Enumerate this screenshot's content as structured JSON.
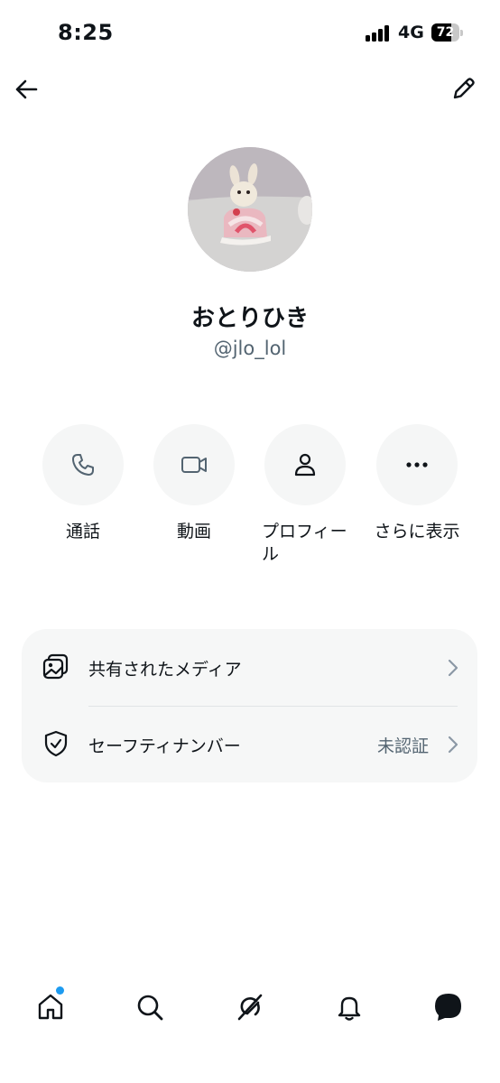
{
  "status_bar": {
    "time": "8:25",
    "network": "4G",
    "battery": "72",
    "battery_level": 0.72
  },
  "header": {
    "back_icon": "arrow-left-icon",
    "edit_icon": "pencil-icon"
  },
  "profile": {
    "display_name": "おとりひき",
    "handle": "@jlo_lol"
  },
  "actions": [
    {
      "label": "通話",
      "icon": "phone-icon"
    },
    {
      "label": "動画",
      "icon": "video-camera-icon"
    },
    {
      "label": "プロフィール",
      "icon": "person-icon"
    },
    {
      "label": "さらに表示",
      "icon": "more-dots-icon"
    }
  ],
  "settings": {
    "shared_media": {
      "label": "共有されたメディア",
      "icon": "media-gallery-icon"
    },
    "safety_number": {
      "label": "セーフティナンバー",
      "status": "未認証",
      "icon": "shield-check-icon"
    }
  },
  "tab_bar": {
    "items": [
      "home-icon",
      "search-icon",
      "grok-icon",
      "notifications-bell-icon",
      "messages-icon"
    ],
    "accent": "#1d9bf0"
  }
}
